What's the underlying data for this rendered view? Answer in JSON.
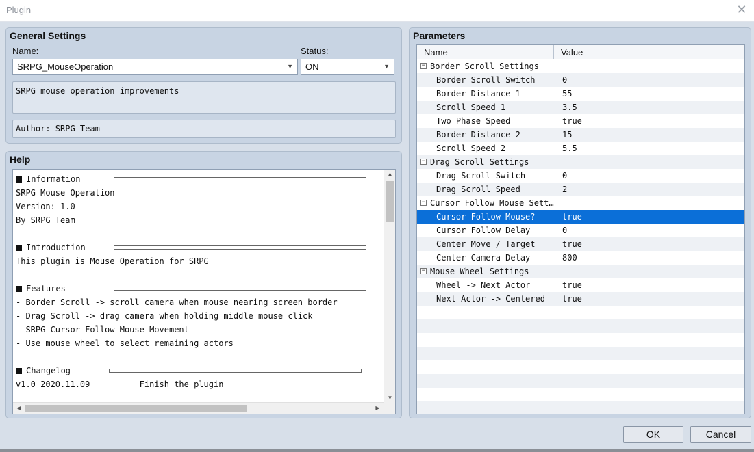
{
  "window": {
    "title": "Plugin",
    "close_glyph": "✕"
  },
  "general": {
    "title": "General Settings",
    "name_label": "Name:",
    "name_value": "SRPG_MouseOperation",
    "status_label": "Status:",
    "status_value": "ON",
    "description": "SRPG mouse operation improvements",
    "author": "Author: SRPG Team"
  },
  "help": {
    "title": "Help",
    "lines": [
      {
        "text": "Information",
        "section": true
      },
      {
        "text": "SRPG Mouse Operation"
      },
      {
        "text": "Version: 1.0"
      },
      {
        "text": "By SRPG Team"
      },
      {
        "text": ""
      },
      {
        "text": "Introduction",
        "section": true
      },
      {
        "text": "This plugin is Mouse Operation for SRPG"
      },
      {
        "text": ""
      },
      {
        "text": "Features",
        "section": true
      },
      {
        "text": "- Border Scroll -> scroll camera when mouse nearing screen border"
      },
      {
        "text": "- Drag Scroll -> drag camera when holding middle mouse click"
      },
      {
        "text": "- SRPG Cursor Follow Mouse Movement"
      },
      {
        "text": "- Use mouse wheel to select remaining actors"
      },
      {
        "text": ""
      },
      {
        "text": "Changelog",
        "section": true
      },
      {
        "text": "v1.0 2020.11.09          Finish the plugin"
      }
    ]
  },
  "parameters": {
    "title": "Parameters",
    "col_name": "Name",
    "col_value": "Value",
    "rows": [
      {
        "name": "Border Scroll Settings",
        "group": true,
        "value": ""
      },
      {
        "name": "Border Scroll Switch",
        "value": "0"
      },
      {
        "name": "Border Distance 1",
        "value": "55"
      },
      {
        "name": "Scroll Speed 1",
        "value": "3.5"
      },
      {
        "name": "Two Phase Speed",
        "value": "true"
      },
      {
        "name": "Border Distance 2",
        "value": "15"
      },
      {
        "name": "Scroll Speed 2",
        "value": "5.5"
      },
      {
        "name": "Drag Scroll Settings",
        "group": true,
        "value": ""
      },
      {
        "name": "Drag Scroll Switch",
        "value": "0"
      },
      {
        "name": "Drag Scroll Speed",
        "value": "2"
      },
      {
        "name": "Cursor Follow Mouse Sett…",
        "group": true,
        "value": ""
      },
      {
        "name": "Cursor Follow Mouse?",
        "value": "true",
        "selected": true
      },
      {
        "name": "Cursor Follow Delay",
        "value": "0"
      },
      {
        "name": "Center Move / Target",
        "value": "true"
      },
      {
        "name": "Center Camera Delay",
        "value": "800"
      },
      {
        "name": "Mouse Wheel Settings",
        "group": true,
        "value": ""
      },
      {
        "name": "Wheel -> Next Actor",
        "value": "true"
      },
      {
        "name": "Next Actor -> Centered",
        "value": "true"
      },
      {
        "name": "",
        "value": ""
      },
      {
        "name": "",
        "value": ""
      },
      {
        "name": "",
        "value": ""
      },
      {
        "name": "",
        "value": ""
      },
      {
        "name": "",
        "value": ""
      },
      {
        "name": "",
        "value": ""
      },
      {
        "name": "",
        "value": ""
      },
      {
        "name": "",
        "value": ""
      }
    ]
  },
  "buttons": {
    "ok": "OK",
    "cancel": "Cancel"
  },
  "colors": {
    "selection": "#0b6fd8",
    "panel": "#c8d4e3",
    "background": "#d7dfe9"
  },
  "icons": {
    "collapse": "minus-box-icon",
    "dropdown": "chevron-down-icon",
    "close": "close-icon"
  }
}
